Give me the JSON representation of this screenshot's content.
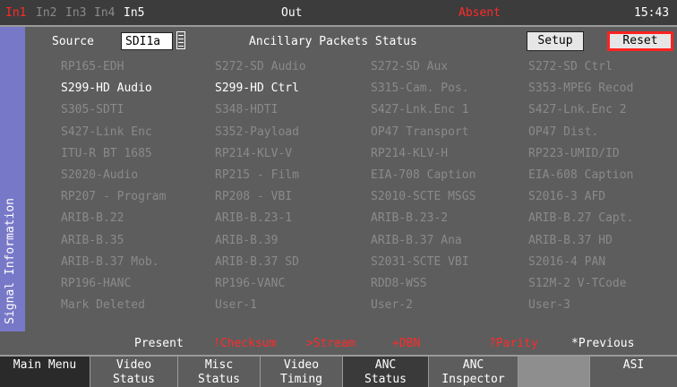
{
  "topbar": {
    "inputs": [
      "In1",
      "In2",
      "In3",
      "In4",
      "In5"
    ],
    "output": "Out",
    "status": "Absent",
    "time": "15:43"
  },
  "sidebar": {
    "label": "Signal Information"
  },
  "source": {
    "label": "Source",
    "value": "SDI1a"
  },
  "panel_title": "Ancillary Packets Status",
  "buttons": {
    "setup": "Setup",
    "reset": "Reset"
  },
  "packets": [
    [
      "RP165-EDH",
      "S272-SD Audio",
      "S272-SD Aux",
      "S272-SD Ctrl"
    ],
    [
      "S299-HD Audio",
      "S299-HD Ctrl",
      "S315-Cam. Pos.",
      "S353-MPEG Recod"
    ],
    [
      "S305-SDTI",
      "S348-HDTI",
      "S427-Lnk.Enc 1",
      "S427-Lnk.Enc 2"
    ],
    [
      "S427-Link Enc",
      "S352-Payload",
      "OP47 Transport",
      "OP47 Dist."
    ],
    [
      "ITU-R BT 1685",
      "RP214-KLV-V",
      "RP214-KLV-H",
      "RP223-UMID/ID"
    ],
    [
      "S2020-Audio",
      "RP215 - Film",
      "EIA-708 Caption",
      "EIA-608 Caption"
    ],
    [
      "RP207 - Program",
      "RP208 - VBI",
      "S2010-SCTE MSGS",
      "S2016-3 AFD"
    ],
    [
      "ARIB-B.22",
      "ARIB-B.23-1",
      "ARIB-B.23-2",
      "ARIB-B.27 Capt."
    ],
    [
      "ARIB-B.35",
      "ARIB-B.39",
      "ARIB-B.37 Ana",
      "ARIB-B.37 HD"
    ],
    [
      "ARIB-B.37 Mob.",
      "ARIB-B.37 SD",
      "S2031-SCTE VBI",
      "S2016-4 PAN"
    ],
    [
      "RP196-HANC",
      "RP196-VANC",
      "RDD8-WSS",
      "S12M-2 V-TCode"
    ],
    [
      "Mark Deleted",
      "User-1",
      "User-2",
      "User-3"
    ]
  ],
  "legend": {
    "present": "Present",
    "checksum": "!Checksum",
    "stream": ">Stream",
    "dbn": "+DBN",
    "parity": "?Parity",
    "previous": "*Previous"
  },
  "menu": [
    [
      "Main Menu",
      ""
    ],
    [
      "Video",
      "Status"
    ],
    [
      "Misc",
      "Status"
    ],
    [
      "Video",
      "Timing"
    ],
    [
      "ANC",
      "Status"
    ],
    [
      "ANC",
      "Inspector"
    ],
    [
      "",
      ""
    ],
    [
      "ASI",
      ""
    ]
  ]
}
